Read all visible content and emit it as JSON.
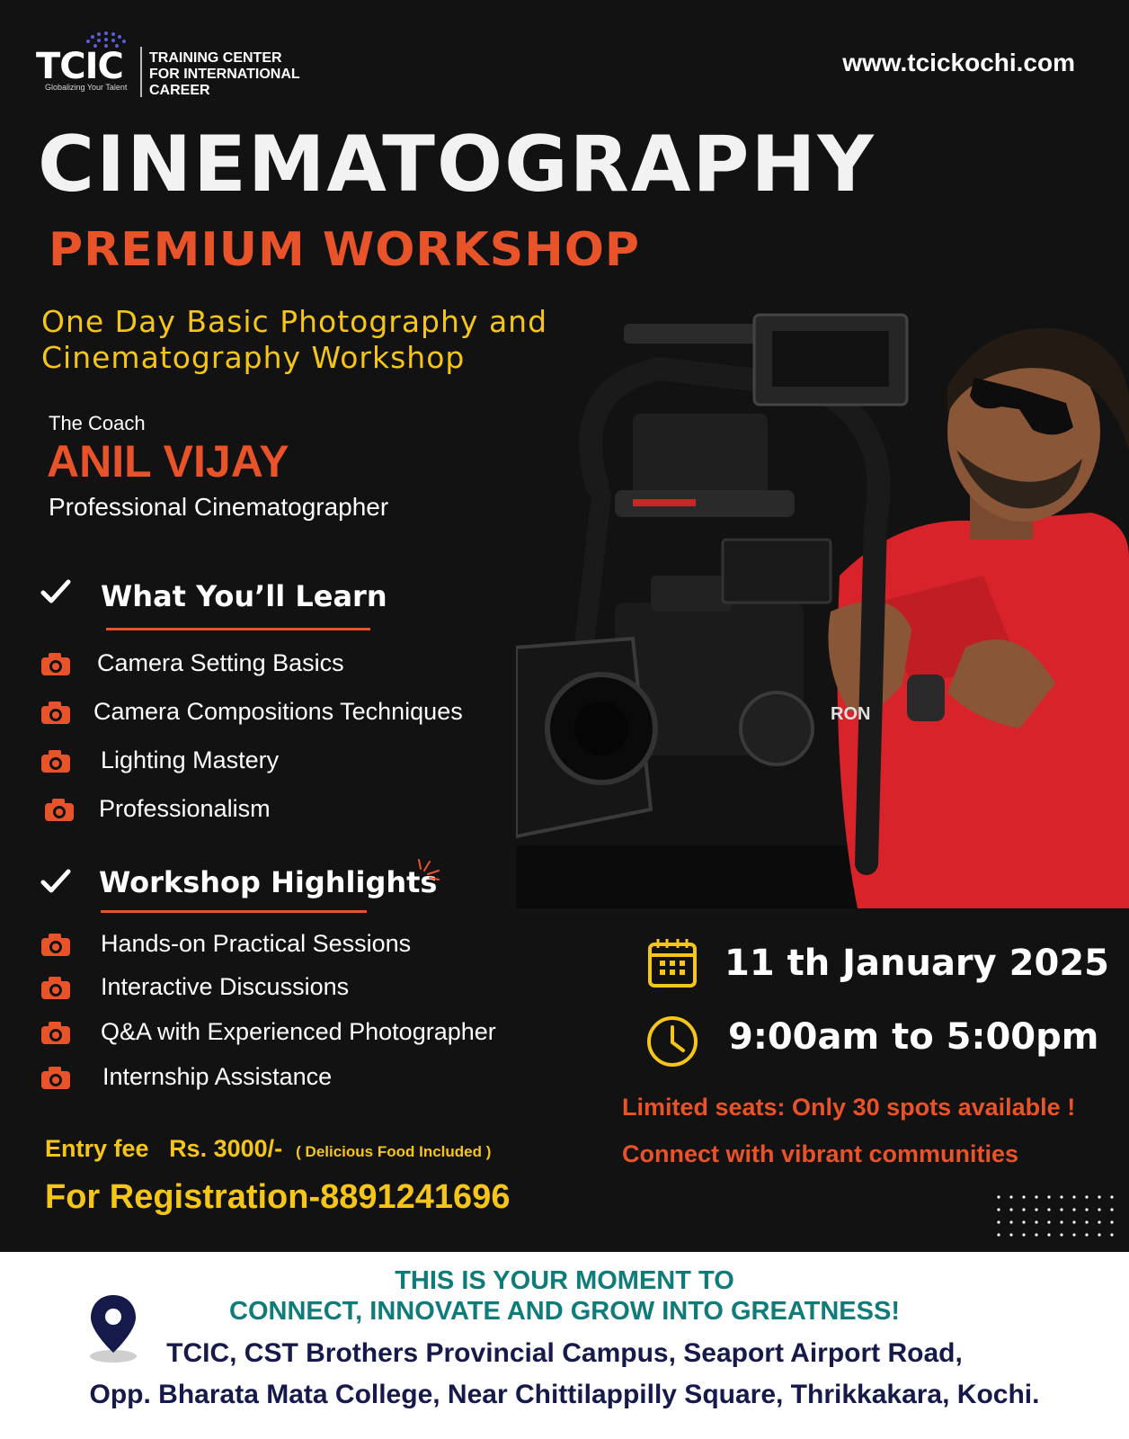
{
  "brand": {
    "logo_text": "TCIC",
    "logo_tagline": "Globalizing Your Talent",
    "org_line1": "TRAINING CENTER",
    "org_line2": "FOR INTERNATIONAL",
    "org_line3": "CAREER",
    "website": "www.tcickochi.com"
  },
  "hero": {
    "title": "CINEMATOGRAPHY",
    "subtitle": "PREMIUM WORKSHOP",
    "tagline_line1": "One Day Basic Photography and",
    "tagline_line2": "Cinematography Workshop"
  },
  "coach": {
    "label": "The Coach",
    "name": "ANIL VIJAY",
    "role": "Professional Cinematographer"
  },
  "learn": {
    "title": "What You’ll Learn",
    "items": [
      "Camera Setting Basics",
      "Camera Compositions Techniques",
      "Lighting Mastery",
      "Professionalism"
    ]
  },
  "highlights": {
    "title": "Workshop Highlights",
    "items": [
      "Hands-on Practical Sessions",
      "Interactive Discussions",
      "Q&A with Experienced Photographer",
      "Internship Assistance"
    ]
  },
  "event": {
    "date": "11 th January 2025",
    "time": "9:00am to 5:00pm",
    "note1": "Limited seats: Only 30 spots available !",
    "note2": "Connect with vibrant  communities"
  },
  "fee": {
    "label": "Entry fee",
    "amount": "Rs. 3000/-",
    "food": "( Delicious Food Included )"
  },
  "registration": "For Registration-8891241696",
  "footer": {
    "head_line1": "THIS IS YOUR MOMENT TO",
    "head_line2": "CONNECT, INNOVATE AND GROW INTO GREATNESS!",
    "addr_line1": "TCIC, CST Brothers Provincial Campus, Seaport Airport Road,",
    "addr_line2": "Opp. Bharata Mata College, Near Chittilappilly Square, Thrikkakara, Kochi."
  },
  "colors": {
    "background": "#121212",
    "accent_orange": "#e8532a",
    "accent_yellow": "#f5c518",
    "footer_teal": "#0f7c7a",
    "footer_navy": "#161a4a"
  },
  "icons": [
    "check-icon",
    "camera-icon",
    "calendar-icon",
    "clock-icon",
    "location-pin-icon"
  ]
}
